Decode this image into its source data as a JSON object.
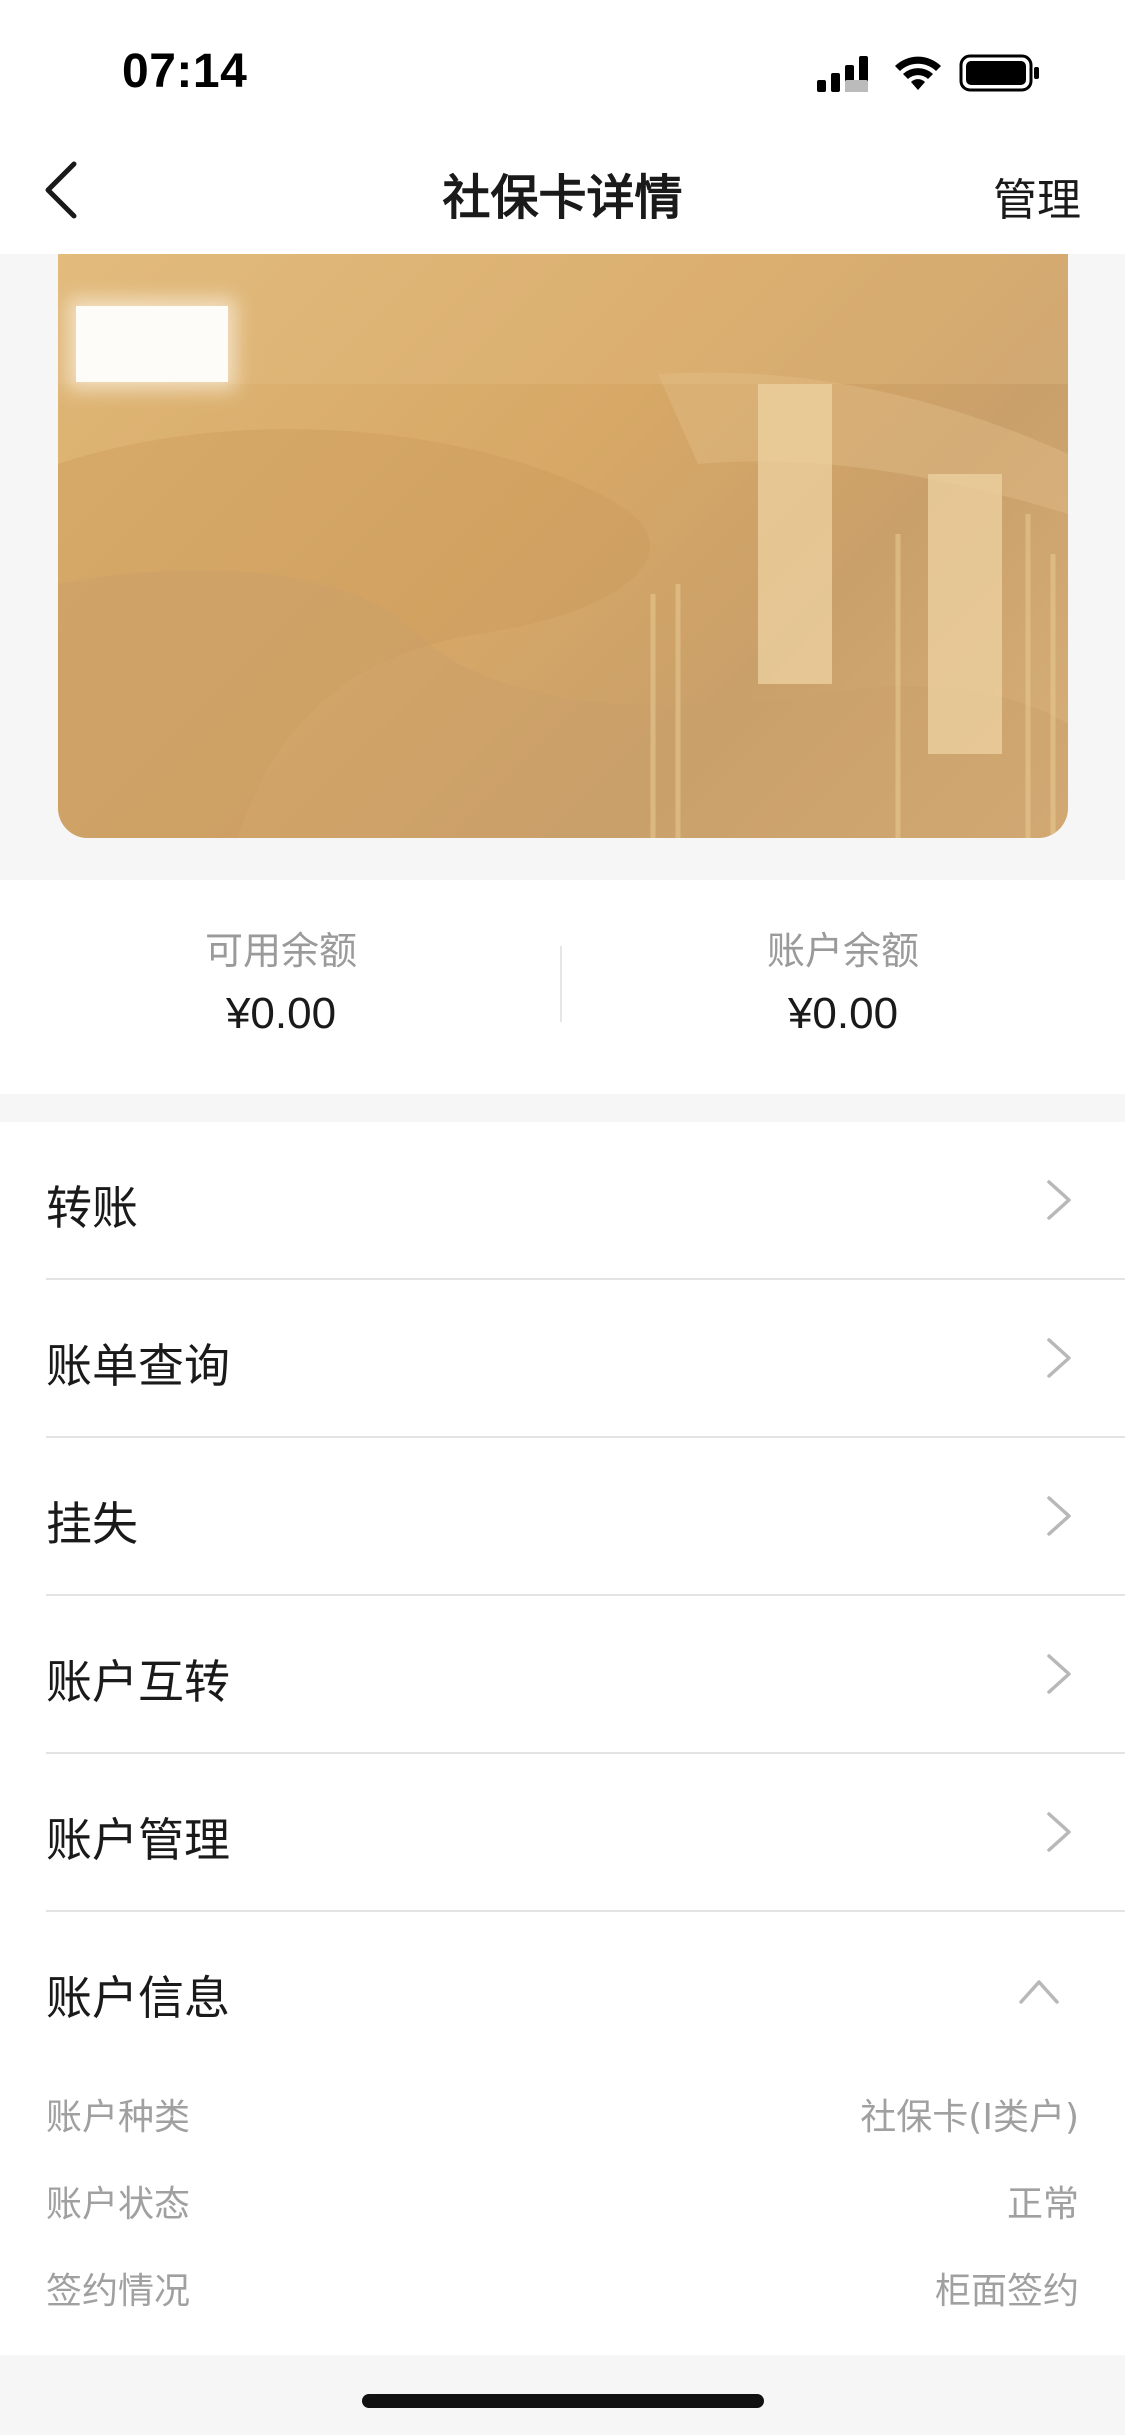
{
  "status_bar": {
    "time": "07:14"
  },
  "nav": {
    "title": "社保卡详情",
    "manage_label": "管理"
  },
  "balances": [
    {
      "label": "可用余额",
      "value": "¥0.00"
    },
    {
      "label": "账户余额",
      "value": "¥0.00"
    }
  ],
  "menu": {
    "items": [
      {
        "label": "转账"
      },
      {
        "label": "账单查询"
      },
      {
        "label": "挂失"
      },
      {
        "label": "账户互转"
      },
      {
        "label": "账户管理"
      }
    ]
  },
  "account_info": {
    "title": "账户信息",
    "rows": [
      {
        "key": "账户种类",
        "value": "社保卡(I类户)"
      },
      {
        "key": "账户状态",
        "value": "正常"
      },
      {
        "key": "签约情况",
        "value": "柜面签约"
      }
    ]
  },
  "colors": {
    "card_gold": "#d7a866",
    "text_primary": "#1a1a1a",
    "text_muted": "#9a9a9a"
  },
  "icons": [
    "signal-icon",
    "wifi-icon",
    "battery-icon",
    "back-arrow-icon",
    "chevron-right-icon",
    "chevron-up-icon"
  ]
}
